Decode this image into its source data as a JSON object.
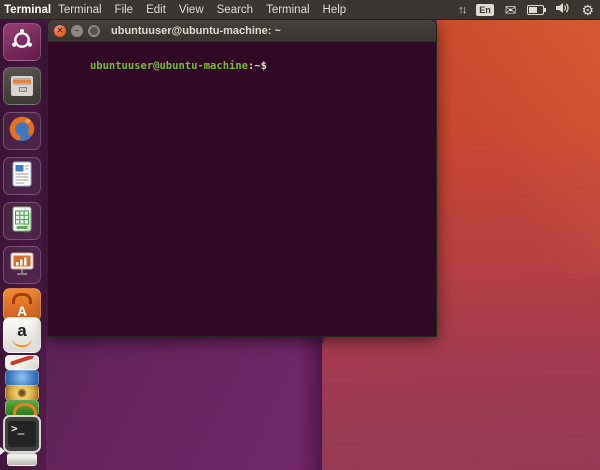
{
  "panel": {
    "app_name": "Terminal",
    "menus": [
      "Terminal",
      "File",
      "Edit",
      "View",
      "Search",
      "Terminal",
      "Help"
    ],
    "indicators": {
      "network_glyph": "↑↓",
      "keyboard_layout": "En",
      "mail_glyph": "✉",
      "session_glyph": "⚙"
    }
  },
  "window": {
    "title": "ubuntuuser@ubuntu-machine: ~"
  },
  "terminal": {
    "prompt_user": "ubuntuuser@ubuntu-machine",
    "prompt_rest": ":~$"
  },
  "launcher": {
    "items": [
      "ubuntu-logo",
      "files",
      "firefox",
      "libreoffice-writer",
      "libreoffice-calc",
      "libreoffice-impress",
      "ubuntu-software",
      "amazon",
      "folded-tool",
      "folded-blue-sphere",
      "folded-gold-disc",
      "folded-green-player",
      "terminal",
      "trash"
    ],
    "software_letter": "A",
    "amazon_letter": "a",
    "terminal_glyph": ">_"
  },
  "colors": {
    "wallpaper_purple": "#6e2765",
    "wallpaper_orange": "#c8482f",
    "wallpaper_crimson": "#9a3853",
    "panel_background": "#3a3733",
    "terminal_background": "#300a24",
    "prompt_green": "#76bb2f",
    "close_button_orange": "#e05a24"
  }
}
